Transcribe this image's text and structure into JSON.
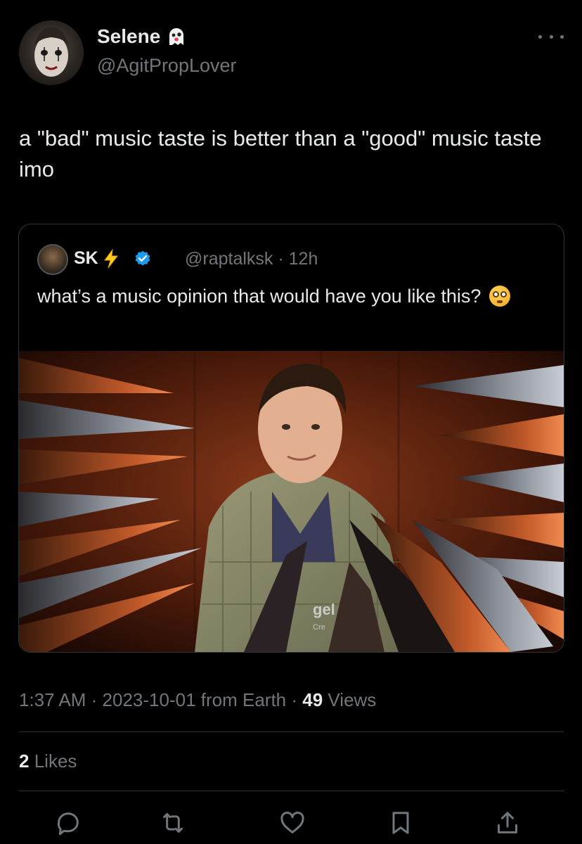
{
  "author": {
    "name": "Selene",
    "handle": "@AgitPropLover"
  },
  "tweet": {
    "text": "a \"bad\" music taste is better than a \"good\" music taste imo"
  },
  "quoted": {
    "name": "SK",
    "handle": "@raptalksk",
    "time": "12h",
    "text": "what’s a music opinion that would have you like this?",
    "image_watermark": "gel",
    "image_watermark2": "Cre"
  },
  "meta": {
    "time": "1:37 AM",
    "date": "2023-10-01",
    "source": "from Earth",
    "views_count": "49",
    "views_label": "Views"
  },
  "stats": {
    "likes_count": "2",
    "likes_label": "Likes"
  },
  "icons": {
    "more": "more-icon",
    "reply": "reply-icon",
    "retweet": "retweet-icon",
    "like": "like-icon",
    "bookmark": "bookmark-icon",
    "share": "share-icon"
  },
  "colors": {
    "background": "#000000",
    "text": "#e7e9ea",
    "muted": "#71767b",
    "verified": "#1d9bf0",
    "border": "#2f3336"
  }
}
